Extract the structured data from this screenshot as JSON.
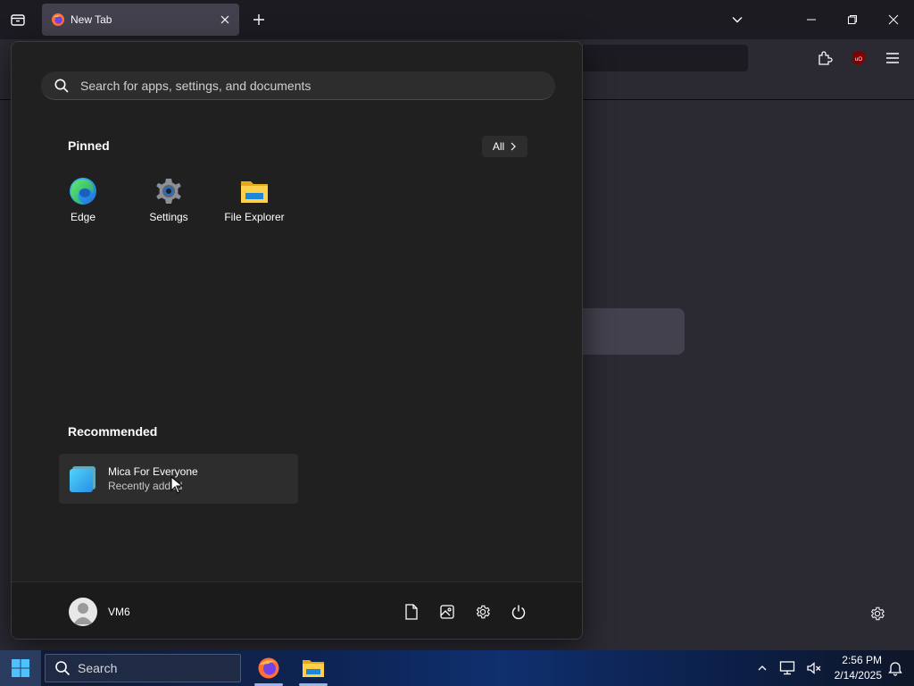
{
  "browser": {
    "tab": {
      "title": "New Tab"
    }
  },
  "start_menu": {
    "search": {
      "placeholder": "Search for apps, settings, and documents"
    },
    "pinned": {
      "title": "Pinned",
      "all_label": "All",
      "apps": [
        {
          "label": "Edge",
          "icon": "edge-icon"
        },
        {
          "label": "Settings",
          "icon": "settings-gear-icon"
        },
        {
          "label": "File Explorer",
          "icon": "folder-icon"
        }
      ]
    },
    "recommended": {
      "title": "Recommended",
      "items": [
        {
          "name": "Mica For Everyone",
          "subtitle": "Recently added",
          "icon": "mica-app-icon"
        }
      ]
    },
    "user": {
      "name": "VM6"
    }
  },
  "taskbar": {
    "search_label": "Search",
    "clock": {
      "time": "2:56 PM",
      "date": "2/14/2025"
    }
  },
  "colors": {
    "accent": "#0078d4",
    "start_bg": "#202020",
    "browser_bg": "#2b2a33"
  }
}
